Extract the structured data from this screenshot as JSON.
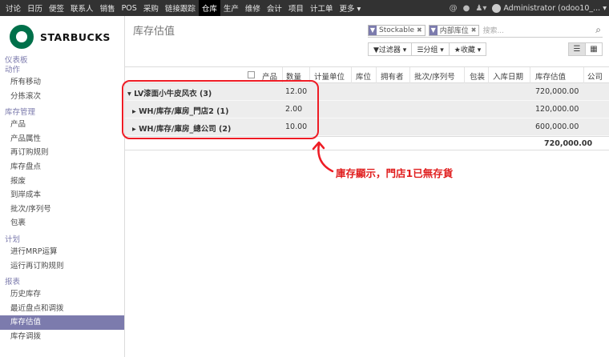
{
  "topnav": {
    "items": [
      "讨论",
      "日历",
      "便签",
      "联系人",
      "销售",
      "POS",
      "采购",
      "链接跟踪",
      "仓库",
      "生产",
      "维修",
      "会计",
      "项目",
      "计工单",
      "更多 ▾"
    ],
    "active_index": 8,
    "user": "Administrator (odoo10_...",
    "icons": [
      "at-icon",
      "chat-icon",
      "bell-icon"
    ]
  },
  "brand": {
    "name": "STARBUCKS"
  },
  "sidebar": {
    "sections": [
      {
        "title": "仪表板",
        "items": []
      },
      {
        "title": "动作",
        "items": [
          "所有移动",
          "分拣滚次"
        ]
      },
      {
        "title": "库存管理",
        "items": [
          "产品",
          "产品属性",
          "再订购规则",
          "库存盘点",
          "报废",
          "到岸成本",
          "批次/序列号",
          "包裹"
        ]
      },
      {
        "title": "计划",
        "items": [
          "进行MRP运算",
          "运行再订购规则"
        ]
      },
      {
        "title": "报表",
        "items": [
          "历史库存",
          "最近盘点和调拨",
          "库存估值",
          "库存调拨"
        ]
      }
    ],
    "active_item": "库存估值"
  },
  "page": {
    "title": "库存估值",
    "search": {
      "facets": [
        "Stockable",
        "内部库位"
      ],
      "placeholder": "搜索..."
    },
    "options": [
      "▼过滤器 ▾",
      "☰分组 ▾",
      "★收藏 ▾"
    ]
  },
  "table": {
    "columns": [
      "产品",
      "数量",
      "计量单位",
      "库位",
      "拥有者",
      "批次/序列号",
      "包装",
      "入库日期",
      "库存估值",
      "公司"
    ],
    "rows": [
      {
        "label": "▾ LV漆面小牛皮风衣 (3)",
        "qty": "12.00",
        "value": "720,000.00",
        "level": 1
      },
      {
        "label": "▸ WH/库存/庫房_門店2 (1)",
        "qty": "2.00",
        "value": "120,000.00",
        "level": 2
      },
      {
        "label": "▸ WH/库存/庫房_總公司 (2)",
        "qty": "10.00",
        "value": "600,000.00",
        "level": 2
      }
    ],
    "total_value": "720,000.00"
  },
  "annotation": {
    "text": "庫存顯示，門店1已無存貨",
    "color": "#ee1c25"
  }
}
